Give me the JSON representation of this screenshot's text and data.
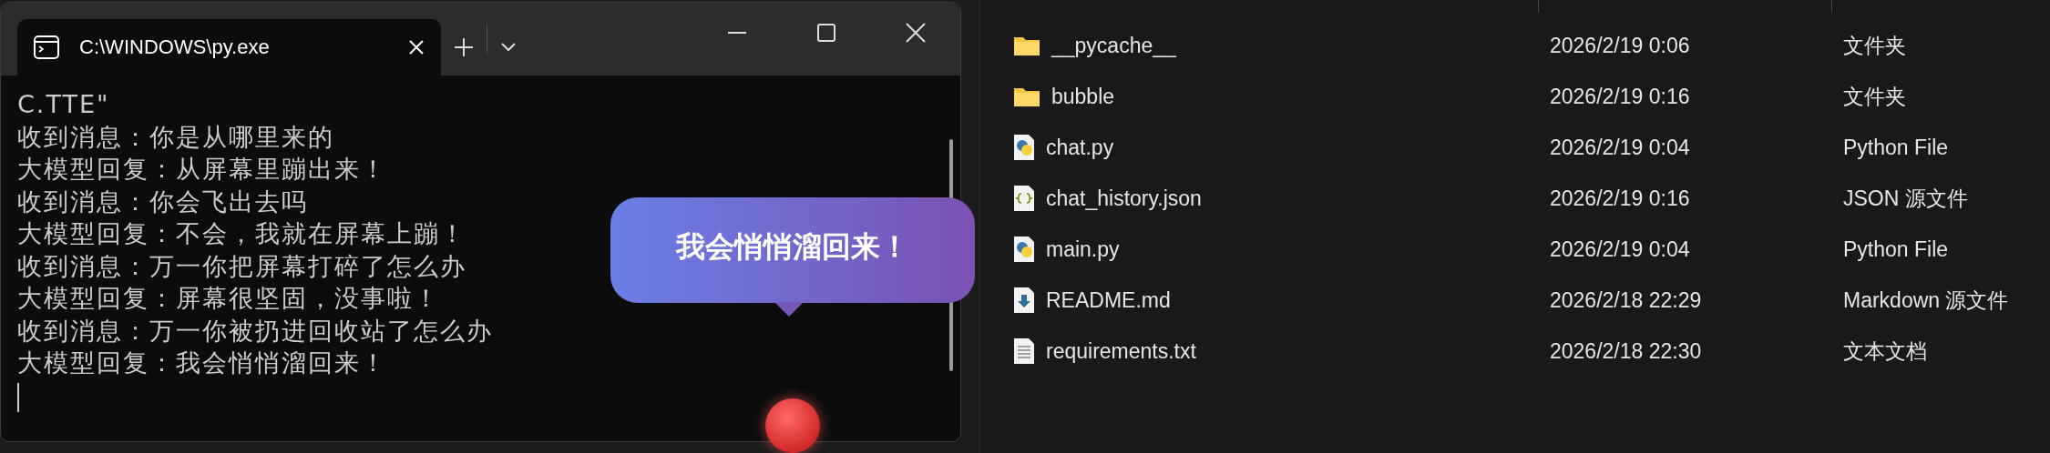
{
  "terminal": {
    "tab": {
      "title": "C:\\WINDOWS\\py.exe",
      "selected": true
    },
    "lines": [
      "C.TTE\"",
      "收到消息：你是从哪里来的",
      "大模型回复：从屏幕里蹦出来！",
      "收到消息：你会飞出去吗",
      "大模型回复：不会，我就在屏幕上蹦！",
      "收到消息：万一你把屏幕打碎了怎么办",
      "大模型回复：屏幕很坚固，没事啦！",
      "收到消息：万一你被扔进回收站了怎么办",
      "大模型回复：我会悄悄溜回来！"
    ]
  },
  "bubble": {
    "text": "我会悄悄溜回来！"
  },
  "files": [
    {
      "name": "__pycache__",
      "modified": "2026/2/19 0:06",
      "type": "文件夹",
      "kind": "folder"
    },
    {
      "name": "bubble",
      "modified": "2026/2/19 0:16",
      "type": "文件夹",
      "kind": "folder"
    },
    {
      "name": "chat.py",
      "modified": "2026/2/19 0:04",
      "type": "Python File",
      "kind": "python"
    },
    {
      "name": "chat_history.json",
      "modified": "2026/2/19 0:16",
      "type": "JSON 源文件",
      "kind": "json"
    },
    {
      "name": "main.py",
      "modified": "2026/2/19 0:04",
      "type": "Python File",
      "kind": "python"
    },
    {
      "name": "README.md",
      "modified": "2026/2/18 22:29",
      "type": "Markdown 源文件",
      "kind": "markdown"
    },
    {
      "name": "requirements.txt",
      "modified": "2026/2/18 22:30",
      "type": "文本文档",
      "kind": "text"
    }
  ]
}
